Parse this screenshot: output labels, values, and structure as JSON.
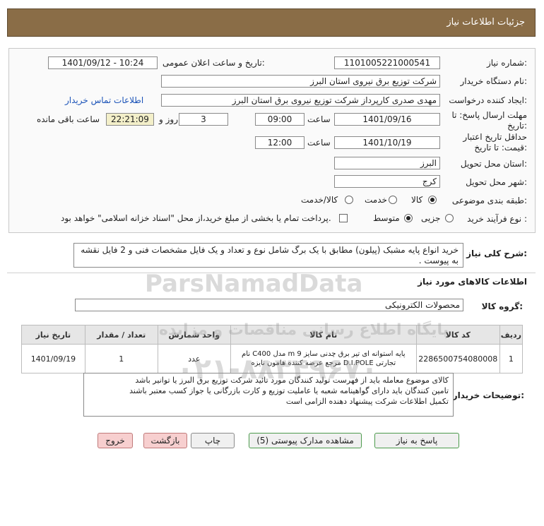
{
  "header": {
    "title": "جزئیات اطلاعات نیاز"
  },
  "fields": {
    "need_number_label": "شماره نیاز:",
    "need_number": "1101005221000541",
    "announce_label": "تاریخ و ساعت اعلان عمومی:",
    "announce_value": "1401/09/12 - 10:24",
    "buyer_label": "نام دستگاه خریدار:",
    "buyer_value": "شرکت توزیع برق نیروی استان البرز",
    "creator_label": "ایجاد کننده درخواست:",
    "creator_value": "مهدی صدری کارپرداز شرکت توزیع نیروی برق استان البرز",
    "contact_link": "اطلاعات تماس خریدار",
    "deadline_label_1": "مهلت ارسال پاسخ: تا",
    "deadline_label_2": "تاریخ:",
    "deadline_date": "1401/09/16",
    "time_label": "ساعت",
    "deadline_time": "09:00",
    "days_value": "3",
    "days_label": "روز و",
    "remaining_time": "22:21:09",
    "remaining_label": "ساعت باقی مانده",
    "validity_label_1": "حداقل تاریخ اعتبار",
    "validity_label_2": "قیمت: تا تاریخ:",
    "validity_date": "1401/10/19",
    "validity_time": "12:00",
    "province_label": "استان محل تحویل:",
    "province_value": "البرز",
    "city_label": "شهر محل تحویل:",
    "city_value": "کرج",
    "category_label": "طبقه بندی موضوعی:",
    "category_options": [
      "کالا",
      "خدمت",
      "کالا/خدمت"
    ],
    "category_selected": "کالا",
    "process_label": "نوع فرآیند خرید :",
    "process_options": [
      "جزیی",
      "متوسط"
    ],
    "process_selected": "متوسط",
    "payment_note": "پرداخت تمام یا بخشی از مبلغ خرید،از محل \"اسناد خزانه اسلامی\" خواهد بود."
  },
  "description": {
    "label": "شرح کلی نیاز:",
    "text": "خرید انواع پایه مشبک (پیلون) مطابق با یک برگ شامل نوع و تعداد و یک فایل مشخصات فنی و 2 فایل نقشه به پیوست ."
  },
  "goods_section": {
    "title": "اطلاعات کالاهای مورد نیاز",
    "group_label": "گروه کالا:",
    "group_value": "محصولات الکترونیکی"
  },
  "table": {
    "headers": [
      "ردیف",
      "کد کالا",
      "نام کالا",
      "واحد شمارش",
      "تعداد / مقدار",
      "تاریخ نیاز"
    ],
    "rows": [
      {
        "row": "1",
        "code": "2286500754080008",
        "name_line1": "پایه استوانه ای تیر برق چدنی سایز m 9 مدل C400 نام",
        "name_line2": "تجارتی D.I.POLE مرجع عرضه کننده هامون نایزه",
        "unit": "عدد",
        "qty": "1",
        "date": "1401/09/19"
      }
    ]
  },
  "notes": {
    "label": "توضیحات خریدار:",
    "lines": [
      "کالای موضوع معامله باید از فهرست تولید کنندگان مورد تائید شرکت توزیع برق البرز یا توانیر باشد",
      "تامین کنندگان باید دارای گواهینامه شعبه یا عاملیت توزیع و کارت بازرگانی یا جواز کسب معتبر باشند",
      "تکمیل اطلاعات شرکت پیشنهاد دهنده  الزامی است"
    ]
  },
  "buttons": {
    "reply": "پاسخ به نیاز",
    "attachments": "مشاهده مدارک پیوستی (5)",
    "print": "چاپ",
    "back": "بازگشت",
    "exit": "خروج"
  },
  "watermark": {
    "brand": "ParsNamadData",
    "subtitle": "پایگاه اطلاع رسانی مناقصات و مزایده",
    "phone": "۰۲۱-۸۸۳۴۹۶۷۰"
  }
}
